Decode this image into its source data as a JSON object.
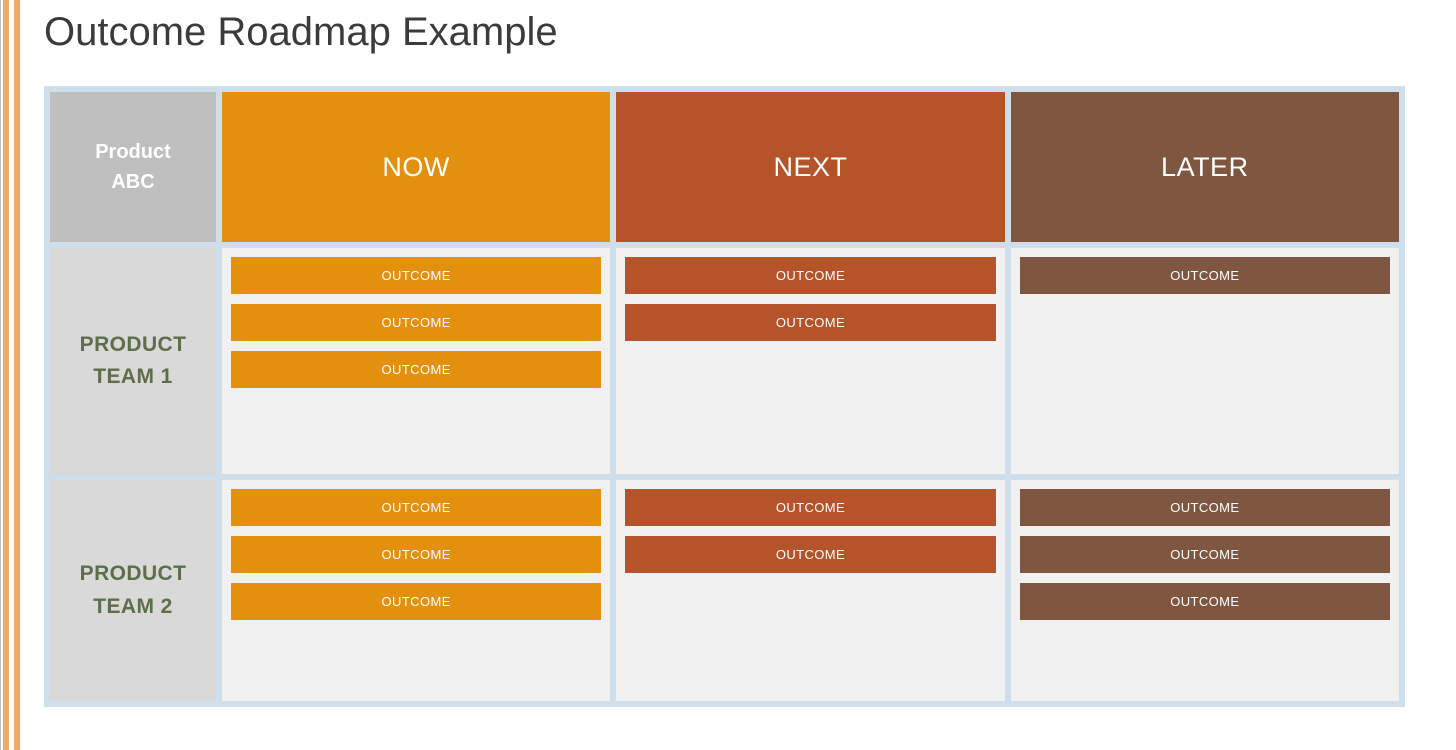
{
  "page": {
    "title": "Outcome Roadmap Example",
    "background_color": "#ffffff"
  },
  "decorations": {
    "edge_stripe_color": "#eeab67",
    "edge_rule_color": "#bfbfbf"
  },
  "colors": {
    "table_frame": "#cfdeeb",
    "corner_header_bg": "#bfbfbf",
    "team_label_bg": "#d9d9d9",
    "team_label_text": "#5e6e4a",
    "lane_body_bg": "#f1f1f1",
    "now": "#e4900f",
    "next": "#b5532a",
    "later": "#7f563f",
    "title_text": "#3b3b3b",
    "header_text": "#ffffff"
  },
  "roadmap": {
    "corner_label_line1": "Product",
    "corner_label_line2": "ABC",
    "columns": [
      {
        "key": "now",
        "label": "NOW",
        "color": "#e4900f"
      },
      {
        "key": "next",
        "label": "NEXT",
        "color": "#b5532a"
      },
      {
        "key": "later",
        "label": "LATER",
        "color": "#7f563f"
      }
    ],
    "rows": [
      {
        "label_line1": "PRODUCT",
        "label_line2": "TEAM 1",
        "lanes": [
          {
            "column": "now",
            "outcomes": [
              "OUTCOME",
              "OUTCOME",
              "OUTCOME"
            ]
          },
          {
            "column": "next",
            "outcomes": [
              "OUTCOME",
              "OUTCOME"
            ]
          },
          {
            "column": "later",
            "outcomes": [
              "OUTCOME"
            ]
          }
        ]
      },
      {
        "label_line1": "PRODUCT",
        "label_line2": "TEAM 2",
        "lanes": [
          {
            "column": "now",
            "outcomes": [
              "OUTCOME",
              "OUTCOME",
              "OUTCOME"
            ]
          },
          {
            "column": "next",
            "outcomes": [
              "OUTCOME",
              "OUTCOME"
            ]
          },
          {
            "column": "later",
            "outcomes": [
              "OUTCOME",
              "OUTCOME",
              "OUTCOME"
            ]
          }
        ]
      }
    ]
  }
}
